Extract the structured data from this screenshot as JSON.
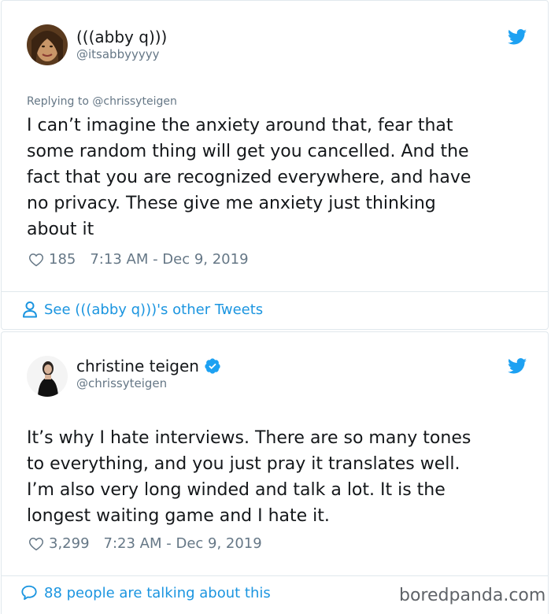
{
  "tweet1": {
    "display_name": "(((abby q)))",
    "handle": "@itsabbyyyyy",
    "replying_to": "Replying to @chrissyteigen",
    "text_lines": [
      "I can’t imagine the anxiety around that, fear that",
      "some random thing will get you cancelled. And the",
      "fact that you are recognized everywhere, and have",
      "no privacy. These give me anxiety just thinking",
      "about it"
    ],
    "likes": "185",
    "timestamp": "7:13 AM - Dec 9, 2019",
    "see_other": "See (((abby q)))'s other Tweets",
    "icon": "twitter-bird-icon"
  },
  "tweet2": {
    "display_name": "christine teigen",
    "handle": "@chrissyteigen",
    "verified": true,
    "text_lines": [
      "It’s why I hate interviews. There are so many tones",
      "to everything, and you just pray it translates well.",
      "I’m also very long winded and talk a lot. It is the",
      "longest waiting game and I hate it."
    ],
    "likes": "3,299",
    "timestamp": "7:23 AM - Dec 9, 2019",
    "talking": "88 people are talking about this",
    "icon": "twitter-bird-icon"
  },
  "watermark": "boredpanda.com",
  "colors": {
    "link_blue": "#1b95e0",
    "twitter_blue": "#1da1f2",
    "muted": "#657786",
    "border": "#e1e8ed"
  }
}
